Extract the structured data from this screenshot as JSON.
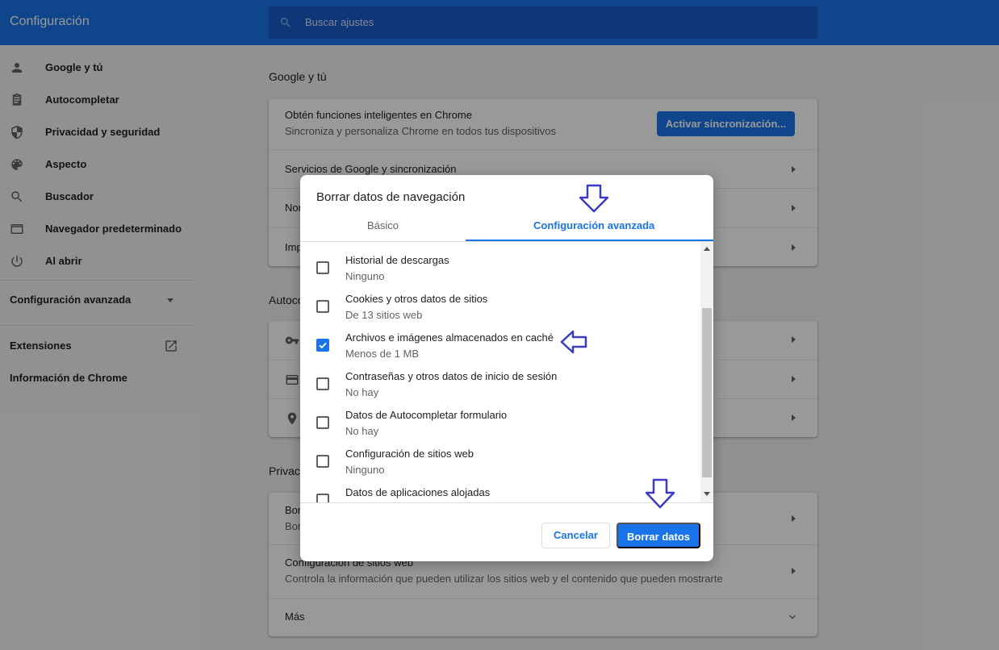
{
  "app_title": "Configuración",
  "search": {
    "placeholder": "Buscar ajustes"
  },
  "sidebar": {
    "items": [
      {
        "label": "Google y tú",
        "icon": "person-icon"
      },
      {
        "label": "Autocompletar",
        "icon": "clipboard-icon"
      },
      {
        "label": "Privacidad y seguridad",
        "icon": "shield-icon"
      },
      {
        "label": "Aspecto",
        "icon": "palette-icon"
      },
      {
        "label": "Buscador",
        "icon": "search-icon"
      },
      {
        "label": "Navegador predeterminado",
        "icon": "browser-icon"
      },
      {
        "label": "Al abrir",
        "icon": "power-icon"
      }
    ],
    "advanced": "Configuración avanzada",
    "extensions": "Extensiones",
    "about": "Información de Chrome"
  },
  "main": {
    "google_section_title": "Google y tú",
    "sync": {
      "title": "Obtén funciones inteligentes en Chrome",
      "subtitle": "Sincroniza y personaliza Chrome en todos tus dispositivos",
      "button": "Activar sincronización..."
    },
    "google_services": "Servicios de Google y sincronización",
    "row_nom_partial": "Nom",
    "row_imp_partial": "Imp",
    "autofill_section_partial": "Autoco",
    "privacy_section_partial": "Privac",
    "privacy_row1_title_partial": "Bor",
    "privacy_row1_sub_partial": "Bor",
    "site_settings": {
      "title": "Configuración de sitios web",
      "subtitle": "Controla la información que pueden utilizar los sitios web y el contenido que pueden mostrarte"
    },
    "more": "Más"
  },
  "dialog": {
    "title": "Borrar datos de navegación",
    "tabs": [
      "Básico",
      "Configuración avanzada"
    ],
    "active_tab": "Configuración avanzada",
    "options": [
      {
        "label": "Historial de descargas",
        "detail": "Ninguno",
        "checked": false
      },
      {
        "label": "Cookies y otros datos de sitios",
        "detail": "De 13 sitios web",
        "checked": false
      },
      {
        "label": "Archivos e imágenes almacenados en caché",
        "detail": "Menos de 1 MB",
        "checked": true
      },
      {
        "label": "Contraseñas y otros datos de inicio de sesión",
        "detail": "No hay",
        "checked": false
      },
      {
        "label": "Datos de Autocompletar formulario",
        "detail": "No hay",
        "checked": false
      },
      {
        "label": "Configuración de sitios web",
        "detail": "Ninguno",
        "checked": false
      },
      {
        "label": "Datos de aplicaciones alojadas",
        "detail": "",
        "checked": false
      }
    ],
    "cancel": "Cancelar",
    "confirm": "Borrar datos"
  },
  "colors": {
    "accent": "#1a73e8",
    "annotation_arrow": "#3b3bc4"
  }
}
